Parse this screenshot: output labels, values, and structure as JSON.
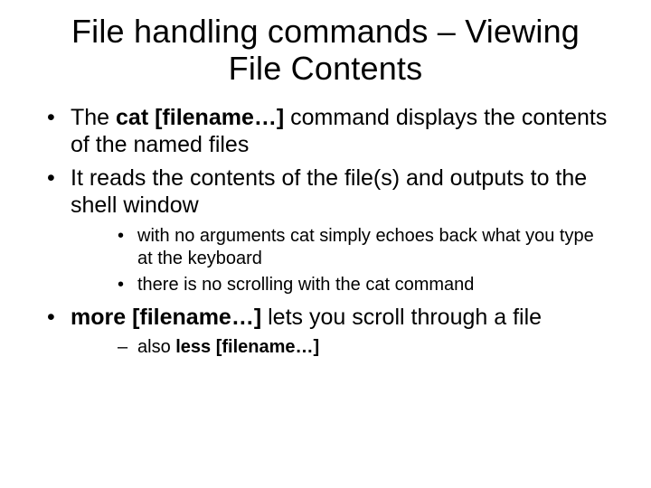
{
  "title": "File handling commands – Viewing File Contents",
  "items": [
    {
      "pre": "The ",
      "bold": "cat [filename…]",
      "post": " command displays the contents of the named files"
    },
    {
      "pre": " It reads the contents of the file(s) and outputs to the shell window",
      "bold": "",
      "post": "",
      "sub": [
        {
          "style": "bullet",
          "pre": "with no arguments cat simply echoes back what you type at the keyboard",
          "bold": "",
          "post": ""
        },
        {
          "style": "bullet",
          "pre": "there is no scrolling with the cat command",
          "bold": "",
          "post": ""
        }
      ]
    },
    {
      "pre": "",
      "bold": "more [filename…]",
      "post": " lets you scroll through a file",
      "sub": [
        {
          "style": "dash",
          "pre": "also ",
          "bold": "less [filename…]",
          "post": ""
        }
      ]
    }
  ]
}
